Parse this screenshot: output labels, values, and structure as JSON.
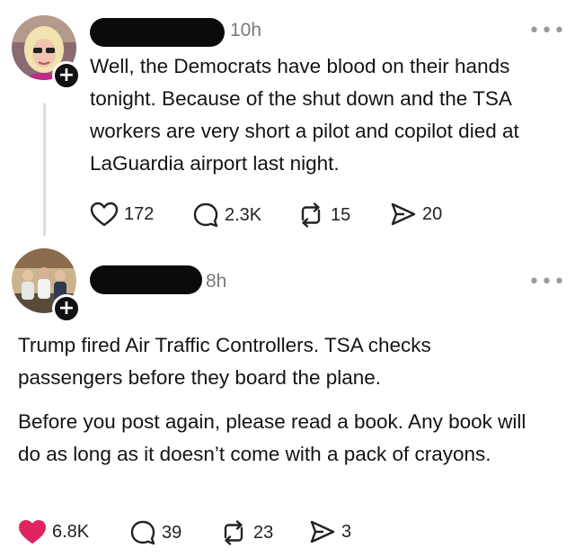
{
  "posts": [
    {
      "time": "10h",
      "more": "•••",
      "text": "Well, the Democrats have blood on their hands tonight. Because of the shut down and the TSA workers are very short a pilot and copilot died at LaGuardia airport last night.",
      "likes": "172",
      "replies": "2.3K",
      "reposts": "15",
      "shares": "20",
      "liked": false
    },
    {
      "time": "8h",
      "more": "•••",
      "paragraphs": [
        "Trump fired Air Traffic Controllers. TSA checks passengers before they board the plane.",
        "Before you post again, please read a book. Any book will do as long as it doesn’t come with a pack of crayons."
      ],
      "likes": "6.8K",
      "replies": "39",
      "reposts": "23",
      "shares": "3",
      "liked": true
    }
  ],
  "follow_symbol": "+",
  "colors": {
    "like_active": "#e0245e",
    "meta": "#7a7a7a",
    "thread_line": "#dcdcdc"
  },
  "icons": [
    "heart-icon",
    "comment-icon",
    "repost-icon",
    "share-icon",
    "plus-icon",
    "more-icon"
  ]
}
